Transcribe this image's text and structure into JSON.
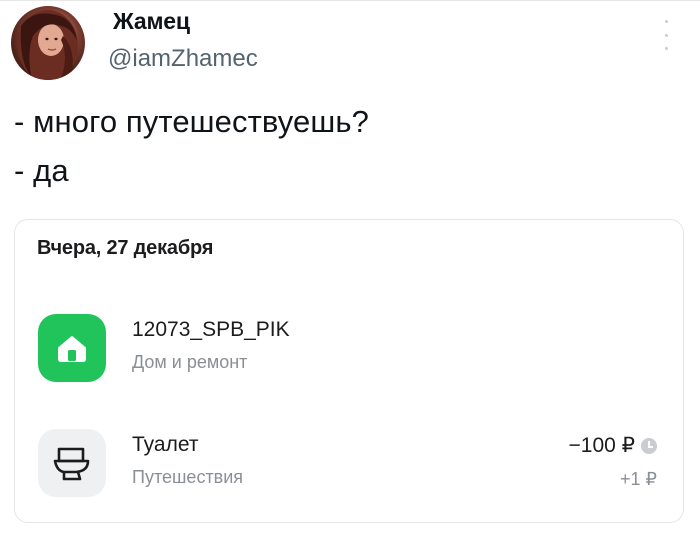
{
  "tweet": {
    "display_name": "Жамец",
    "handle": "@iamZhamec",
    "lines": [
      "- много путешествуешь?",
      "- да"
    ]
  },
  "card": {
    "date": "Вчера, 27 декабря",
    "transactions": [
      {
        "title": "12073_SPB_PIK",
        "category": "Дом и ремонт",
        "icon": "home-icon",
        "icon_bg": "#21c45a"
      },
      {
        "title": "Туалет",
        "category": "Путешествия",
        "amount": "−100 ₽",
        "cashback": "+1 ₽",
        "icon": "toilet-icon",
        "icon_bg": "#eef0f2",
        "status_icon": "clock-icon"
      }
    ]
  },
  "colors": {
    "accent_green": "#21c45a",
    "muted_text": "#8a8f95",
    "handle_text": "#536471"
  }
}
